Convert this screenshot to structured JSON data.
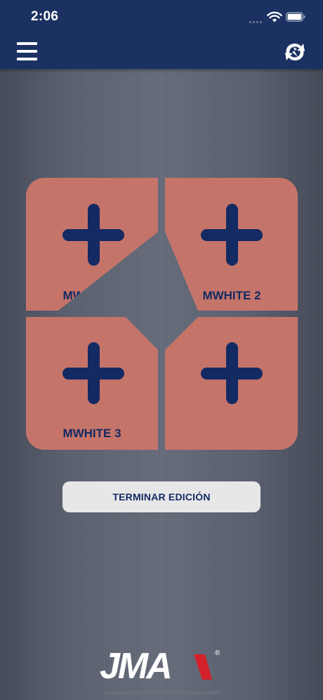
{
  "status_bar": {
    "time": "2:06"
  },
  "header": {
    "menu_icon": "hamburger-menu-icon",
    "sync_icon": "sync-icon"
  },
  "key_slots": [
    {
      "label": "MWHITE 1",
      "icon": "plus-icon"
    },
    {
      "label": "MWHITE 2",
      "icon": "plus-icon"
    },
    {
      "label": "MWHITE 3",
      "icon": "plus-icon"
    },
    {
      "label": "",
      "icon": "plus-icon"
    }
  ],
  "actions": {
    "finish_edit_label": "TERMINAR EDICIÓN"
  },
  "brand": {
    "logo_text": "JMA",
    "registered_mark": "®"
  },
  "colors": {
    "header_bg": "#1a3161",
    "slot_bg": "#c5746a",
    "accent_navy": "#132a63",
    "button_bg": "#e7e7e8",
    "logo_red": "#d3212c"
  }
}
